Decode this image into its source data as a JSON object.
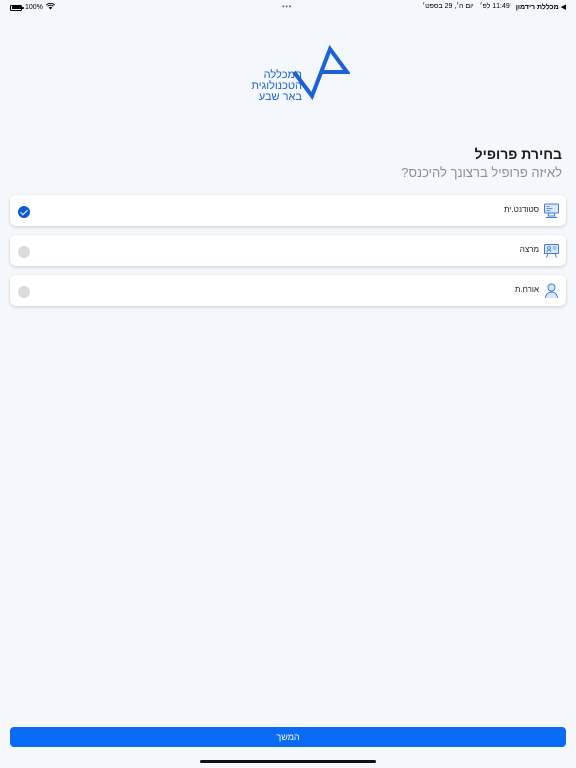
{
  "status_bar": {
    "battery": "100%",
    "time": "11:49 לפ׳",
    "date": "יום ה׳, 29 בספט׳",
    "carrier": "◀ מכללת רידמון",
    "dots": "•••"
  },
  "logo": {
    "line1": "המכללה",
    "line2": "הטכנולוגית",
    "line3": "באר שבע"
  },
  "header": {
    "title": "בחירת פרופיל",
    "subtitle": "לאיזה פרופיל ברצונך להיכנס?"
  },
  "options": [
    {
      "label": "סטודנט.ית",
      "icon": "student-computer-icon",
      "selected": true
    },
    {
      "label": "מרצה",
      "icon": "lecturer-board-icon",
      "selected": false
    },
    {
      "label": "אורח.ת",
      "icon": "guest-person-icon",
      "selected": false
    }
  ],
  "footer": {
    "continue_label": "המשך"
  },
  "colors": {
    "accent": "#0a6cf5",
    "check": "#0a5bdb",
    "logo": "#1a62d6",
    "background": "#f4f7fb"
  }
}
